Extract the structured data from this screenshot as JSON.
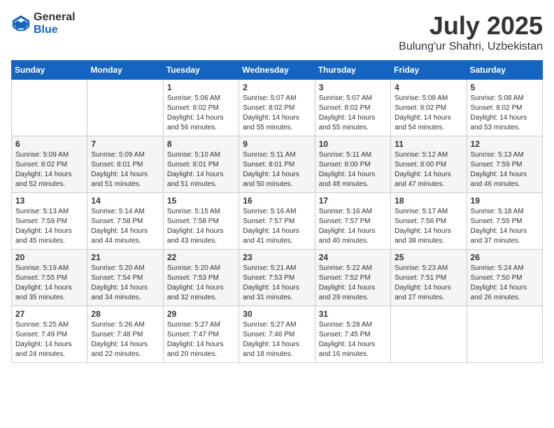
{
  "logo": {
    "general": "General",
    "blue": "Blue"
  },
  "title": "July 2025",
  "subtitle": "Bulung'ur Shahri, Uzbekistan",
  "headers": [
    "Sunday",
    "Monday",
    "Tuesday",
    "Wednesday",
    "Thursday",
    "Friday",
    "Saturday"
  ],
  "weeks": [
    [
      {
        "day": "",
        "info": ""
      },
      {
        "day": "",
        "info": ""
      },
      {
        "day": "1",
        "info": "Sunrise: 5:06 AM\nSunset: 8:02 PM\nDaylight: 14 hours and 56 minutes."
      },
      {
        "day": "2",
        "info": "Sunrise: 5:07 AM\nSunset: 8:02 PM\nDaylight: 14 hours and 55 minutes."
      },
      {
        "day": "3",
        "info": "Sunrise: 5:07 AM\nSunset: 8:02 PM\nDaylight: 14 hours and 55 minutes."
      },
      {
        "day": "4",
        "info": "Sunrise: 5:08 AM\nSunset: 8:02 PM\nDaylight: 14 hours and 54 minutes."
      },
      {
        "day": "5",
        "info": "Sunrise: 5:08 AM\nSunset: 8:02 PM\nDaylight: 14 hours and 53 minutes."
      }
    ],
    [
      {
        "day": "6",
        "info": "Sunrise: 5:09 AM\nSunset: 8:02 PM\nDaylight: 14 hours and 52 minutes."
      },
      {
        "day": "7",
        "info": "Sunrise: 5:09 AM\nSunset: 8:01 PM\nDaylight: 14 hours and 51 minutes."
      },
      {
        "day": "8",
        "info": "Sunrise: 5:10 AM\nSunset: 8:01 PM\nDaylight: 14 hours and 51 minutes."
      },
      {
        "day": "9",
        "info": "Sunrise: 5:11 AM\nSunset: 8:01 PM\nDaylight: 14 hours and 50 minutes."
      },
      {
        "day": "10",
        "info": "Sunrise: 5:11 AM\nSunset: 8:00 PM\nDaylight: 14 hours and 48 minutes."
      },
      {
        "day": "11",
        "info": "Sunrise: 5:12 AM\nSunset: 8:00 PM\nDaylight: 14 hours and 47 minutes."
      },
      {
        "day": "12",
        "info": "Sunrise: 5:13 AM\nSunset: 7:59 PM\nDaylight: 14 hours and 46 minutes."
      }
    ],
    [
      {
        "day": "13",
        "info": "Sunrise: 5:13 AM\nSunset: 7:59 PM\nDaylight: 14 hours and 45 minutes."
      },
      {
        "day": "14",
        "info": "Sunrise: 5:14 AM\nSunset: 7:58 PM\nDaylight: 14 hours and 44 minutes."
      },
      {
        "day": "15",
        "info": "Sunrise: 5:15 AM\nSunset: 7:58 PM\nDaylight: 14 hours and 43 minutes."
      },
      {
        "day": "16",
        "info": "Sunrise: 5:16 AM\nSunset: 7:57 PM\nDaylight: 14 hours and 41 minutes."
      },
      {
        "day": "17",
        "info": "Sunrise: 5:16 AM\nSunset: 7:57 PM\nDaylight: 14 hours and 40 minutes."
      },
      {
        "day": "18",
        "info": "Sunrise: 5:17 AM\nSunset: 7:56 PM\nDaylight: 14 hours and 38 minutes."
      },
      {
        "day": "19",
        "info": "Sunrise: 5:18 AM\nSunset: 7:55 PM\nDaylight: 14 hours and 37 minutes."
      }
    ],
    [
      {
        "day": "20",
        "info": "Sunrise: 5:19 AM\nSunset: 7:55 PM\nDaylight: 14 hours and 35 minutes."
      },
      {
        "day": "21",
        "info": "Sunrise: 5:20 AM\nSunset: 7:54 PM\nDaylight: 14 hours and 34 minutes."
      },
      {
        "day": "22",
        "info": "Sunrise: 5:20 AM\nSunset: 7:53 PM\nDaylight: 14 hours and 32 minutes."
      },
      {
        "day": "23",
        "info": "Sunrise: 5:21 AM\nSunset: 7:53 PM\nDaylight: 14 hours and 31 minutes."
      },
      {
        "day": "24",
        "info": "Sunrise: 5:22 AM\nSunset: 7:52 PM\nDaylight: 14 hours and 29 minutes."
      },
      {
        "day": "25",
        "info": "Sunrise: 5:23 AM\nSunset: 7:51 PM\nDaylight: 14 hours and 27 minutes."
      },
      {
        "day": "26",
        "info": "Sunrise: 5:24 AM\nSunset: 7:50 PM\nDaylight: 14 hours and 26 minutes."
      }
    ],
    [
      {
        "day": "27",
        "info": "Sunrise: 5:25 AM\nSunset: 7:49 PM\nDaylight: 14 hours and 24 minutes."
      },
      {
        "day": "28",
        "info": "Sunrise: 5:26 AM\nSunset: 7:48 PM\nDaylight: 14 hours and 22 minutes."
      },
      {
        "day": "29",
        "info": "Sunrise: 5:27 AM\nSunset: 7:47 PM\nDaylight: 14 hours and 20 minutes."
      },
      {
        "day": "30",
        "info": "Sunrise: 5:27 AM\nSunset: 7:46 PM\nDaylight: 14 hours and 18 minutes."
      },
      {
        "day": "31",
        "info": "Sunrise: 5:28 AM\nSunset: 7:45 PM\nDaylight: 14 hours and 16 minutes."
      },
      {
        "day": "",
        "info": ""
      },
      {
        "day": "",
        "info": ""
      }
    ]
  ]
}
